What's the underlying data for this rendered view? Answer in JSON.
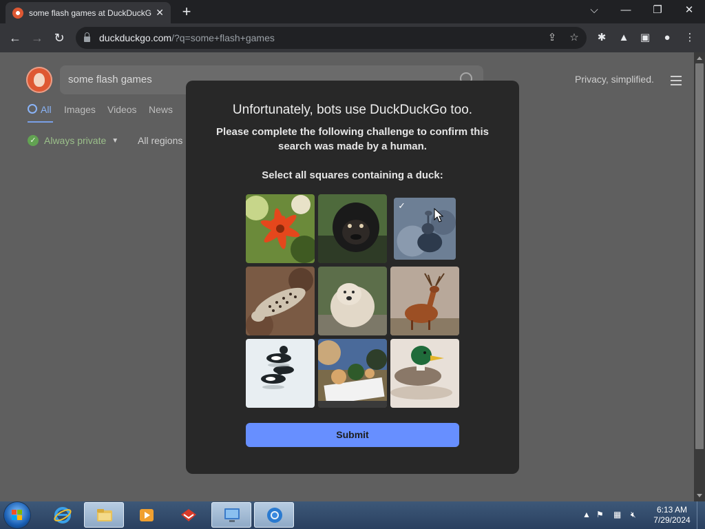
{
  "browser": {
    "tab_title": "some flash games at DuckDuckGo",
    "url_domain": "duckduckgo.com",
    "url_rest": "/?q=some+flash+games"
  },
  "page": {
    "search_query": "some flash games",
    "tagline": "Privacy, simplified.",
    "tabs": [
      {
        "label": "All",
        "active": true
      },
      {
        "label": "Images"
      },
      {
        "label": "Videos"
      },
      {
        "label": "News"
      }
    ],
    "always_private": "Always private",
    "regions": "All regions"
  },
  "modal": {
    "title": "Unfortunately, bots use DuckDuckGo too.",
    "subtitle": "Please complete the following challenge to confirm this search was made by a human.",
    "prompt": "Select all squares containing a duck:",
    "submit_label": "Submit",
    "tiles": [
      {
        "subject": "tiger-lily",
        "selected": false
      },
      {
        "subject": "gorilla",
        "selected": false
      },
      {
        "subject": "bird",
        "selected": true
      },
      {
        "subject": "leopard",
        "selected": false
      },
      {
        "subject": "polar-bear",
        "selected": false
      },
      {
        "subject": "deer",
        "selected": false
      },
      {
        "subject": "ducks-on-water",
        "selected": false
      },
      {
        "subject": "puppies-in-planter",
        "selected": false
      },
      {
        "subject": "mallard-duck",
        "selected": false
      }
    ]
  },
  "taskbar": {
    "time": "6:13 AM",
    "date": "7/29/2024"
  },
  "colors": {
    "submit": "#678fff",
    "modal_bg": "#282828",
    "overlay": "#5f5f5f",
    "accent_blue": "#8ab4f8"
  }
}
